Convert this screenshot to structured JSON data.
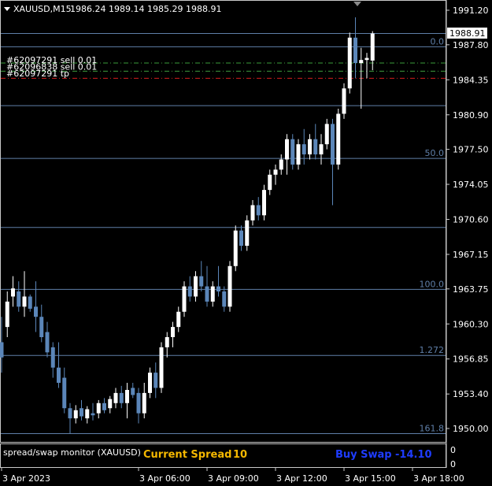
{
  "header": {
    "symbol_timeframe": "XAUUSD,M15",
    "ohlc": "1986.24 1989.14 1985.29 1988.91"
  },
  "price_tag": "1988.91",
  "orders": [
    {
      "label": "#62097291 sell 0.01",
      "price": 1986.0,
      "color": "#3c9c3c"
    },
    {
      "label": "#62096838 sell 0.01",
      "price": 1985.2,
      "color": "#3c9c3c"
    },
    {
      "label": "#62097291 tp",
      "price": 1984.5,
      "color": "#d21e1e"
    }
  ],
  "fib_levels": [
    {
      "label": "0.0",
      "price": 1987.6
    },
    {
      "label": "",
      "price": 1981.8
    },
    {
      "label": "50.0",
      "price": 1976.6
    },
    {
      "label": "",
      "price": 1969.8
    },
    {
      "label": "100.0",
      "price": 1963.7
    },
    {
      "label": "1.272",
      "price": 1957.2
    },
    {
      "label": "161.8",
      "price": 1949.5
    }
  ],
  "top_line_price": 1988.91,
  "indicator": {
    "name": "spread/swap monitor (XAUUSD)",
    "spread_label": "Current Spread",
    "spread_value": "10",
    "swap_label": "Buy Swap",
    "swap_value": "-14.10",
    "spread_color": "#f5b800",
    "swap_color": "#1e3cff",
    "scale_top": "0",
    "scale_bottom": "0"
  },
  "colors": {
    "bull": "#ffffff",
    "bear": "#5b86b9",
    "grid_line": "#5f7fa8"
  },
  "chart_data": {
    "type": "candlestick",
    "title": "XAUUSD,M15",
    "ylim": [
      1949.0,
      1992.4
    ],
    "y_ticks": [
      "1991.20",
      "1987.80",
      "1984.35",
      "1980.90",
      "1977.50",
      "1974.05",
      "1970.60",
      "1967.15",
      "1963.75",
      "1960.30",
      "1956.85",
      "1953.40",
      "1950.00"
    ],
    "x_ticks": [
      {
        "label": "3 Apr 2023",
        "index": 0
      },
      {
        "label": "3 Apr 06:00",
        "index": 24
      },
      {
        "label": "3 Apr 09:00",
        "index": 36
      },
      {
        "label": "3 Apr 12:00",
        "index": 48
      },
      {
        "label": "3 Apr 15:00",
        "index": 60
      },
      {
        "label": "3 Apr 18:00",
        "index": 72
      }
    ],
    "ohlc": [
      [
        1958.5,
        1961.0,
        1955.5,
        1957.0
      ],
      [
        1960.0,
        1963.5,
        1959.0,
        1962.5
      ],
      [
        1963.0,
        1965.0,
        1962.0,
        1963.8
      ],
      [
        1963.5,
        1964.5,
        1961.5,
        1962.0
      ],
      [
        1962.0,
        1965.5,
        1961.0,
        1963.0
      ],
      [
        1963.0,
        1963.2,
        1961.5,
        1961.8
      ],
      [
        1962.0,
        1964.5,
        1959.5,
        1961.0
      ],
      [
        1961.0,
        1962.2,
        1958.5,
        1959.0
      ],
      [
        1959.5,
        1960.5,
        1957.0,
        1957.5
      ],
      [
        1958.0,
        1958.5,
        1955.0,
        1956.0
      ],
      [
        1956.0,
        1958.5,
        1954.0,
        1954.5
      ],
      [
        1955.0,
        1956.0,
        1951.5,
        1952.0
      ],
      [
        1952.0,
        1952.5,
        1949.5,
        1951.0
      ],
      [
        1951.0,
        1952.3,
        1950.5,
        1951.8
      ],
      [
        1952.0,
        1952.8,
        1950.8,
        1951.2
      ],
      [
        1951.0,
        1952.2,
        1950.5,
        1951.9
      ],
      [
        1951.5,
        1952.5,
        1950.8,
        1951.3
      ],
      [
        1951.5,
        1952.8,
        1951.0,
        1952.5
      ],
      [
        1952.5,
        1953.0,
        1951.5,
        1951.8
      ],
      [
        1952.0,
        1953.2,
        1951.5,
        1952.9
      ],
      [
        1952.5,
        1954.0,
        1952.0,
        1953.5
      ],
      [
        1953.5,
        1954.2,
        1952.0,
        1952.5
      ],
      [
        1952.5,
        1954.5,
        1951.0,
        1953.8
      ],
      [
        1954.0,
        1954.5,
        1953.0,
        1953.3
      ],
      [
        1953.5,
        1954.0,
        1950.5,
        1951.5
      ],
      [
        1951.5,
        1954.5,
        1951.0,
        1953.5
      ],
      [
        1953.5,
        1956.0,
        1953.0,
        1955.5
      ],
      [
        1955.5,
        1956.5,
        1953.0,
        1954.0
      ],
      [
        1954.0,
        1958.5,
        1953.5,
        1958.0
      ],
      [
        1958.0,
        1959.5,
        1957.0,
        1959.0
      ],
      [
        1959.0,
        1960.5,
        1958.0,
        1960.0
      ],
      [
        1960.0,
        1962.0,
        1959.5,
        1961.5
      ],
      [
        1961.5,
        1964.5,
        1961.0,
        1964.0
      ],
      [
        1964.0,
        1965.0,
        1962.5,
        1963.0
      ],
      [
        1963.0,
        1965.5,
        1962.5,
        1965.0
      ],
      [
        1965.0,
        1966.5,
        1963.5,
        1964.0
      ],
      [
        1964.0,
        1966.0,
        1962.0,
        1962.5
      ],
      [
        1962.5,
        1964.5,
        1962.0,
        1964.0
      ],
      [
        1964.0,
        1966.0,
        1963.0,
        1963.5
      ],
      [
        1963.5,
        1964.0,
        1961.5,
        1962.0
      ],
      [
        1962.0,
        1966.5,
        1961.5,
        1966.0
      ],
      [
        1966.0,
        1970.0,
        1965.5,
        1969.5
      ],
      [
        1969.5,
        1970.0,
        1967.5,
        1968.0
      ],
      [
        1968.0,
        1971.0,
        1967.5,
        1970.5
      ],
      [
        1970.5,
        1972.5,
        1970.0,
        1972.0
      ],
      [
        1972.0,
        1972.8,
        1970.5,
        1971.0
      ],
      [
        1971.0,
        1974.0,
        1970.5,
        1973.5
      ],
      [
        1973.5,
        1975.5,
        1973.0,
        1975.0
      ],
      [
        1975.0,
        1976.0,
        1974.0,
        1975.5
      ],
      [
        1975.5,
        1977.0,
        1975.0,
        1976.5
      ],
      [
        1976.5,
        1979.0,
        1975.0,
        1978.5
      ],
      [
        1978.5,
        1979.0,
        1975.5,
        1976.0
      ],
      [
        1976.0,
        1978.5,
        1975.5,
        1978.0
      ],
      [
        1978.0,
        1979.5,
        1976.0,
        1977.0
      ],
      [
        1977.0,
        1979.0,
        1976.5,
        1978.5
      ],
      [
        1978.5,
        1980.0,
        1976.5,
        1977.0
      ],
      [
        1977.0,
        1979.0,
        1976.0,
        1978.0
      ],
      [
        1978.0,
        1980.5,
        1977.5,
        1980.0
      ],
      [
        1980.0,
        1980.5,
        1972.0,
        1976.0
      ],
      [
        1976.0,
        1981.5,
        1975.5,
        1981.0
      ],
      [
        1981.0,
        1984.0,
        1980.5,
        1983.5
      ],
      [
        1983.5,
        1989.0,
        1983.0,
        1988.5
      ],
      [
        1988.5,
        1990.5,
        1984.5,
        1986.0
      ],
      [
        1986.0,
        1987.5,
        1981.5,
        1986.3
      ],
      [
        1986.3,
        1987.0,
        1984.5,
        1986.5
      ],
      [
        1986.24,
        1989.14,
        1985.29,
        1988.91
      ]
    ]
  }
}
